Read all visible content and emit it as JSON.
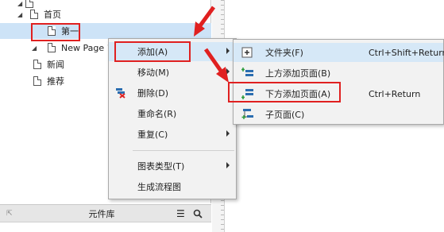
{
  "tree": {
    "home": "首页",
    "first": "第一",
    "new_page": "New Page 1",
    "news": "新闻",
    "recommend": "推荐"
  },
  "library": {
    "title": "元件库"
  },
  "context_menu": {
    "add": "添加(A)",
    "move": "移动(M)",
    "delete": "删除(D)",
    "rename": "重命名(R)",
    "repeat": "重复(C)",
    "chart_type": "图表类型(T)",
    "gen_flow": "生成流程图"
  },
  "submenu": {
    "folder": "文件夹(F)",
    "folder_shortcut": "Ctrl+Shift+Return",
    "add_above": "上方添加页面(B)",
    "add_below": "下方添加页面(A)",
    "add_below_shortcut": "Ctrl+Return",
    "child_page": "子页面(C)"
  },
  "colors": {
    "highlight": "#e02020",
    "selected_row": "#cde3f7",
    "hover_item": "#d6e8f7"
  }
}
